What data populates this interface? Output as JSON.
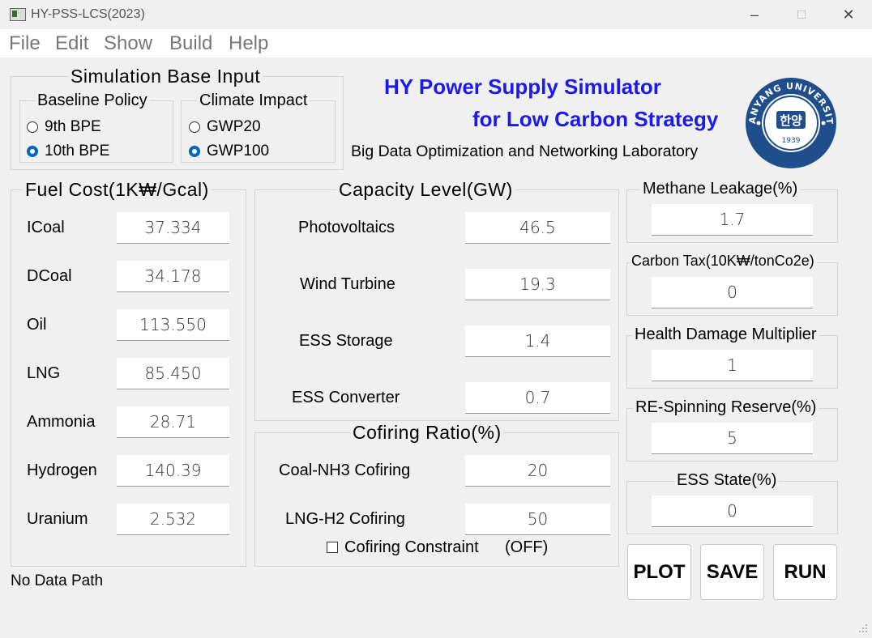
{
  "window": {
    "title": "HY-PSS-LCS(2023)",
    "minimize_icon": "–",
    "maximize_icon": "☐",
    "close_icon": "✕"
  },
  "menu": [
    "File",
    "Edit",
    "Show",
    "Build",
    "Help"
  ],
  "base_input": {
    "title": "Simulation Base Input",
    "baseline": {
      "title": "Baseline Policy",
      "options": [
        "9th BPE",
        "10th BPE"
      ],
      "selected": "10th BPE"
    },
    "climate": {
      "title": "Climate Impact",
      "options": [
        "GWP20",
        "GWP100"
      ],
      "selected": "GWP100"
    }
  },
  "header": {
    "line1": "HY Power Supply Simulator",
    "line2": "for Low Carbon Strategy",
    "lab": "Big Data Optimization and Networking Laboratory",
    "accent_color": "#1a1aee"
  },
  "logo": {
    "top_text": "HANYANG UNIVERSITY",
    "center_text": "한양",
    "year": "1939",
    "color": "#1f4e8c"
  },
  "fuel_cost": {
    "title": "Fuel Cost(1K₩/Gcal)",
    "items": [
      {
        "label": "ICoal",
        "value": "37.334"
      },
      {
        "label": "DCoal",
        "value": "34.178"
      },
      {
        "label": "Oil",
        "value": "113.550"
      },
      {
        "label": "LNG",
        "value": "85.450"
      },
      {
        "label": "Ammonia",
        "value": "28.71"
      },
      {
        "label": "Hydrogen",
        "value": "140.39"
      },
      {
        "label": "Uranium",
        "value": "2.532"
      }
    ]
  },
  "capacity": {
    "title": "Capacity Level(GW)",
    "items": [
      {
        "label": "Photovoltaics",
        "value": "46.5"
      },
      {
        "label": "Wind Turbine",
        "value": "19.3"
      },
      {
        "label": "ESS Storage",
        "value": "1.4"
      },
      {
        "label": "ESS Converter",
        "value": "0.7"
      }
    ]
  },
  "cofiring": {
    "title": "Cofiring Ratio(%)",
    "items": [
      {
        "label": "Coal-NH3 Cofiring",
        "value": "20"
      },
      {
        "label": "LNG-H2 Cofiring",
        "value": "50"
      }
    ],
    "constraint_label": "Cofiring Constraint",
    "constraint_state": "(OFF)"
  },
  "side_params": [
    {
      "label": "Methane Leakage(%)",
      "value": "1.7"
    },
    {
      "label": "Carbon Tax(10K₩/tonCo2e)",
      "value": "0"
    },
    {
      "label": "Health Damage Multiplier",
      "value": "1"
    },
    {
      "label": "RE-Spinning Reserve(%)",
      "value": "5"
    },
    {
      "label": "ESS State(%)",
      "value": "0"
    }
  ],
  "buttons": {
    "plot": "PLOT",
    "save": "SAVE",
    "run": "RUN"
  },
  "status": "No Data Path"
}
